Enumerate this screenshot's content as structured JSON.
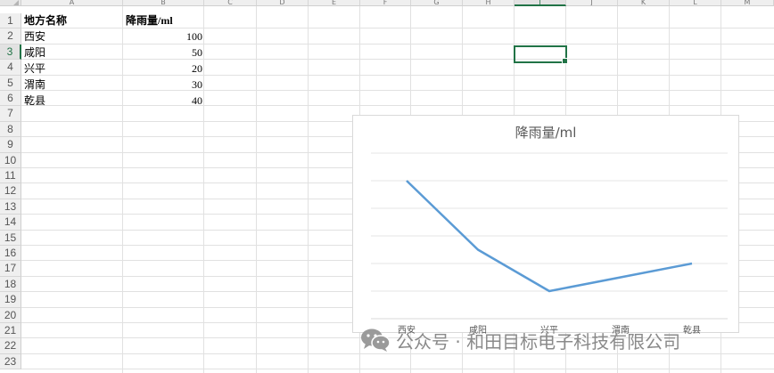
{
  "columns": [
    "A",
    "B",
    "C",
    "D",
    "E",
    "F",
    "G",
    "H",
    "I",
    "J",
    "K",
    "L",
    "M"
  ],
  "active_column": "I",
  "rows": [
    "1",
    "2",
    "3",
    "4",
    "5",
    "6",
    "7",
    "8",
    "9",
    "10",
    "11",
    "12",
    "13",
    "14",
    "15",
    "16",
    "17",
    "18",
    "19",
    "20",
    "21",
    "22",
    "23"
  ],
  "active_row": "3",
  "table": {
    "header": [
      "地方名称",
      "降雨量/ml"
    ],
    "rows": [
      [
        "西安",
        "100"
      ],
      [
        "咸阳",
        "50"
      ],
      [
        "兴平",
        "20"
      ],
      [
        "渭南",
        "30"
      ],
      [
        "乾县",
        "40"
      ]
    ]
  },
  "chart_data": {
    "type": "line",
    "title": "降雨量/ml",
    "categories": [
      "西安",
      "咸阳",
      "兴平",
      "渭南",
      "乾县"
    ],
    "series": [
      {
        "name": "降雨量/ml",
        "values": [
          100,
          50,
          20,
          30,
          40
        ]
      }
    ],
    "ylim": [
      0,
      120
    ],
    "grid": true,
    "line_color": "#5b9bd5"
  },
  "watermark": {
    "text": "公众号 · 和田目标电子科技有限公司",
    "icon": "wechat-icon"
  },
  "colors": {
    "accent": "#217346",
    "line": "#5b9bd5"
  }
}
